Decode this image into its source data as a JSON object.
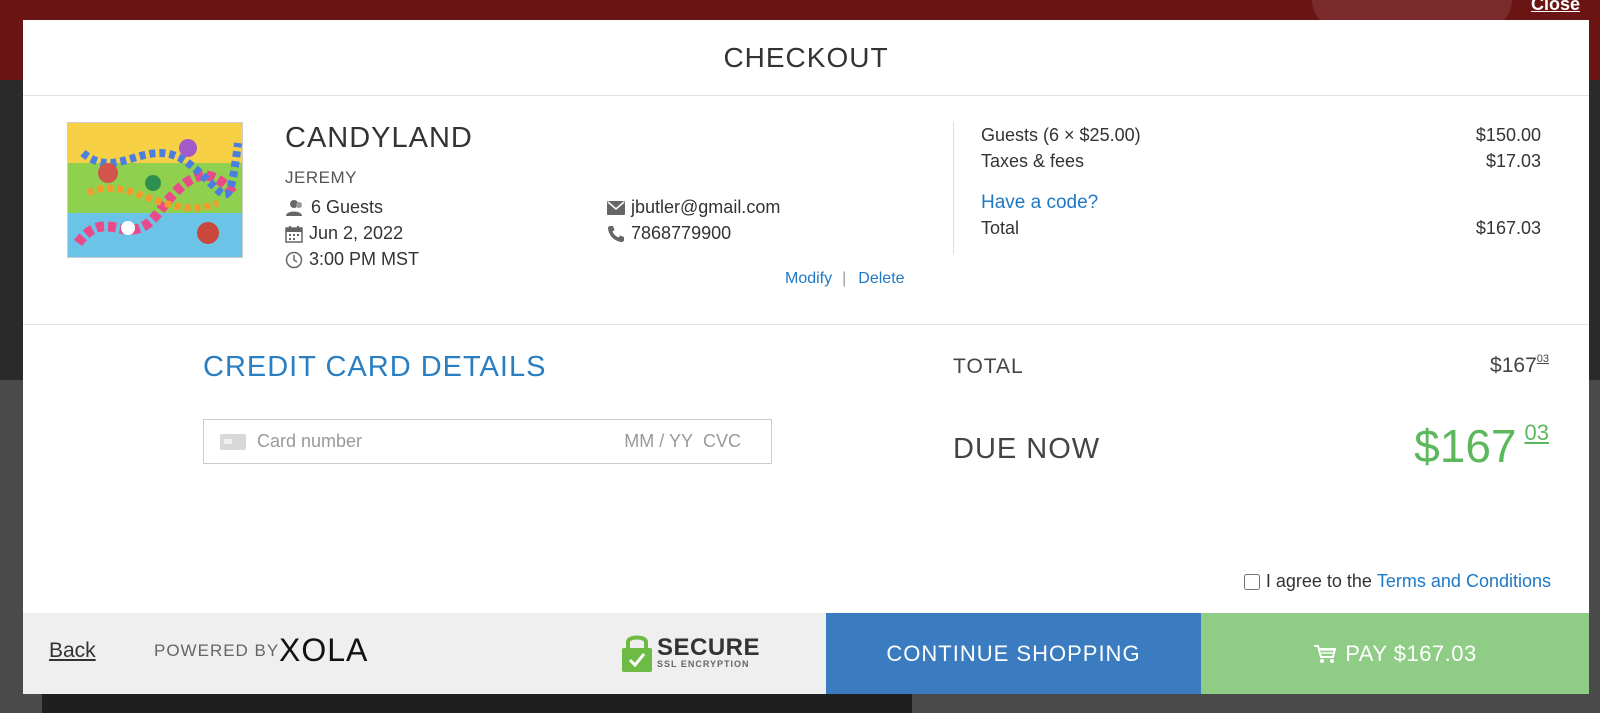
{
  "header": {
    "close_label": "Close",
    "title": "CHECKOUT"
  },
  "booking": {
    "event_name": "CANDYLAND",
    "guest_name": "JEREMY",
    "guests": "6 Guests",
    "date": "Jun 2, 2022",
    "time": "3:00 PM MST",
    "email": "jbutler@gmail.com",
    "phone": "7868779900",
    "modify_label": "Modify",
    "delete_label": "Delete"
  },
  "pricing": {
    "guests_line_label": "Guests (6 × $25.00)",
    "guests_line_amount": "$150.00",
    "taxes_label": "Taxes & fees",
    "taxes_amount": "$17.03",
    "code_link": "Have a code?",
    "total_label": "Total",
    "total_amount": "$167.03"
  },
  "payment": {
    "title": "CREDIT CARD DETAILS",
    "card_placeholder": "Card number",
    "exp_placeholder": "MM / YY",
    "cvc_placeholder": "CVC",
    "total_label": "TOTAL",
    "total_whole": "$167",
    "total_cents": "03",
    "due_label": "DUE NOW",
    "due_whole": "$167",
    "due_cents": "03",
    "agree_text": "I agree to the",
    "terms_link": "Terms and Conditions"
  },
  "footer": {
    "back_label": "Back",
    "powered_by": "POWERED BY",
    "brand": "XOLA",
    "secure_title": "SECURE",
    "secure_subtitle": "SSL ENCRYPTION",
    "continue_label": "CONTINUE SHOPPING",
    "pay_label": "PAY $167.03"
  },
  "icons": {
    "guests": "user-group-icon",
    "date": "calendar-icon",
    "time": "clock-icon",
    "email": "envelope-icon",
    "phone": "phone-icon",
    "card": "credit-card-icon",
    "cart": "cart-icon",
    "lock": "padlock-icon"
  },
  "colors": {
    "accent_blue": "#1f78c6",
    "continue_bg": "#3a7cbf",
    "pay_bg": "#8fcc85",
    "due_green": "#5cb85c"
  }
}
